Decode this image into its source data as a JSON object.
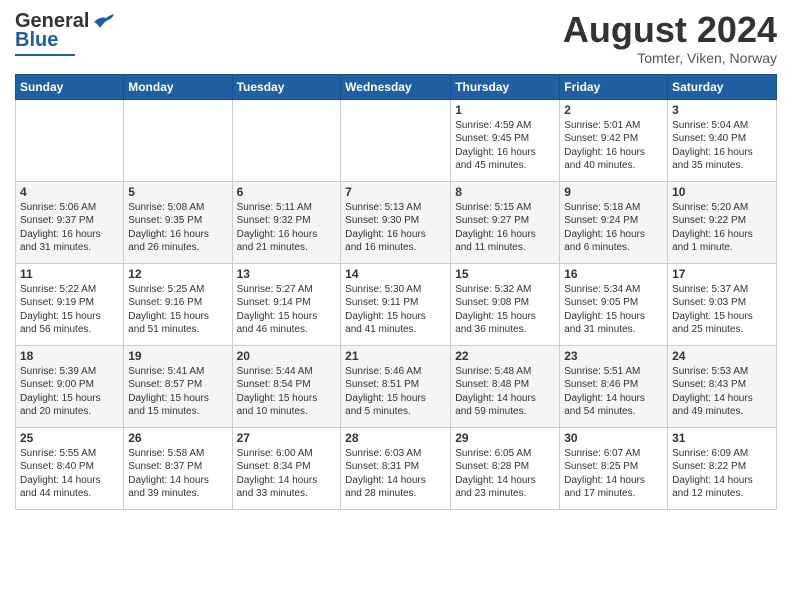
{
  "header": {
    "logo_general": "General",
    "logo_blue": "Blue",
    "month_title": "August 2024",
    "location": "Tomter, Viken, Norway"
  },
  "days_of_week": [
    "Sunday",
    "Monday",
    "Tuesday",
    "Wednesday",
    "Thursday",
    "Friday",
    "Saturday"
  ],
  "weeks": [
    [
      {
        "day": "",
        "info": ""
      },
      {
        "day": "",
        "info": ""
      },
      {
        "day": "",
        "info": ""
      },
      {
        "day": "",
        "info": ""
      },
      {
        "day": "1",
        "info": "Sunrise: 4:59 AM\nSunset: 9:45 PM\nDaylight: 16 hours\nand 45 minutes."
      },
      {
        "day": "2",
        "info": "Sunrise: 5:01 AM\nSunset: 9:42 PM\nDaylight: 16 hours\nand 40 minutes."
      },
      {
        "day": "3",
        "info": "Sunrise: 5:04 AM\nSunset: 9:40 PM\nDaylight: 16 hours\nand 35 minutes."
      }
    ],
    [
      {
        "day": "4",
        "info": "Sunrise: 5:06 AM\nSunset: 9:37 PM\nDaylight: 16 hours\nand 31 minutes."
      },
      {
        "day": "5",
        "info": "Sunrise: 5:08 AM\nSunset: 9:35 PM\nDaylight: 16 hours\nand 26 minutes."
      },
      {
        "day": "6",
        "info": "Sunrise: 5:11 AM\nSunset: 9:32 PM\nDaylight: 16 hours\nand 21 minutes."
      },
      {
        "day": "7",
        "info": "Sunrise: 5:13 AM\nSunset: 9:30 PM\nDaylight: 16 hours\nand 16 minutes."
      },
      {
        "day": "8",
        "info": "Sunrise: 5:15 AM\nSunset: 9:27 PM\nDaylight: 16 hours\nand 11 minutes."
      },
      {
        "day": "9",
        "info": "Sunrise: 5:18 AM\nSunset: 9:24 PM\nDaylight: 16 hours\nand 6 minutes."
      },
      {
        "day": "10",
        "info": "Sunrise: 5:20 AM\nSunset: 9:22 PM\nDaylight: 16 hours\nand 1 minute."
      }
    ],
    [
      {
        "day": "11",
        "info": "Sunrise: 5:22 AM\nSunset: 9:19 PM\nDaylight: 15 hours\nand 56 minutes."
      },
      {
        "day": "12",
        "info": "Sunrise: 5:25 AM\nSunset: 9:16 PM\nDaylight: 15 hours\nand 51 minutes."
      },
      {
        "day": "13",
        "info": "Sunrise: 5:27 AM\nSunset: 9:14 PM\nDaylight: 15 hours\nand 46 minutes."
      },
      {
        "day": "14",
        "info": "Sunrise: 5:30 AM\nSunset: 9:11 PM\nDaylight: 15 hours\nand 41 minutes."
      },
      {
        "day": "15",
        "info": "Sunrise: 5:32 AM\nSunset: 9:08 PM\nDaylight: 15 hours\nand 36 minutes."
      },
      {
        "day": "16",
        "info": "Sunrise: 5:34 AM\nSunset: 9:05 PM\nDaylight: 15 hours\nand 31 minutes."
      },
      {
        "day": "17",
        "info": "Sunrise: 5:37 AM\nSunset: 9:03 PM\nDaylight: 15 hours\nand 25 minutes."
      }
    ],
    [
      {
        "day": "18",
        "info": "Sunrise: 5:39 AM\nSunset: 9:00 PM\nDaylight: 15 hours\nand 20 minutes."
      },
      {
        "day": "19",
        "info": "Sunrise: 5:41 AM\nSunset: 8:57 PM\nDaylight: 15 hours\nand 15 minutes."
      },
      {
        "day": "20",
        "info": "Sunrise: 5:44 AM\nSunset: 8:54 PM\nDaylight: 15 hours\nand 10 minutes."
      },
      {
        "day": "21",
        "info": "Sunrise: 5:46 AM\nSunset: 8:51 PM\nDaylight: 15 hours\nand 5 minutes."
      },
      {
        "day": "22",
        "info": "Sunrise: 5:48 AM\nSunset: 8:48 PM\nDaylight: 14 hours\nand 59 minutes."
      },
      {
        "day": "23",
        "info": "Sunrise: 5:51 AM\nSunset: 8:46 PM\nDaylight: 14 hours\nand 54 minutes."
      },
      {
        "day": "24",
        "info": "Sunrise: 5:53 AM\nSunset: 8:43 PM\nDaylight: 14 hours\nand 49 minutes."
      }
    ],
    [
      {
        "day": "25",
        "info": "Sunrise: 5:55 AM\nSunset: 8:40 PM\nDaylight: 14 hours\nand 44 minutes."
      },
      {
        "day": "26",
        "info": "Sunrise: 5:58 AM\nSunset: 8:37 PM\nDaylight: 14 hours\nand 39 minutes."
      },
      {
        "day": "27",
        "info": "Sunrise: 6:00 AM\nSunset: 8:34 PM\nDaylight: 14 hours\nand 33 minutes."
      },
      {
        "day": "28",
        "info": "Sunrise: 6:03 AM\nSunset: 8:31 PM\nDaylight: 14 hours\nand 28 minutes."
      },
      {
        "day": "29",
        "info": "Sunrise: 6:05 AM\nSunset: 8:28 PM\nDaylight: 14 hours\nand 23 minutes."
      },
      {
        "day": "30",
        "info": "Sunrise: 6:07 AM\nSunset: 8:25 PM\nDaylight: 14 hours\nand 17 minutes."
      },
      {
        "day": "31",
        "info": "Sunrise: 6:09 AM\nSunset: 8:22 PM\nDaylight: 14 hours\nand 12 minutes."
      }
    ]
  ]
}
